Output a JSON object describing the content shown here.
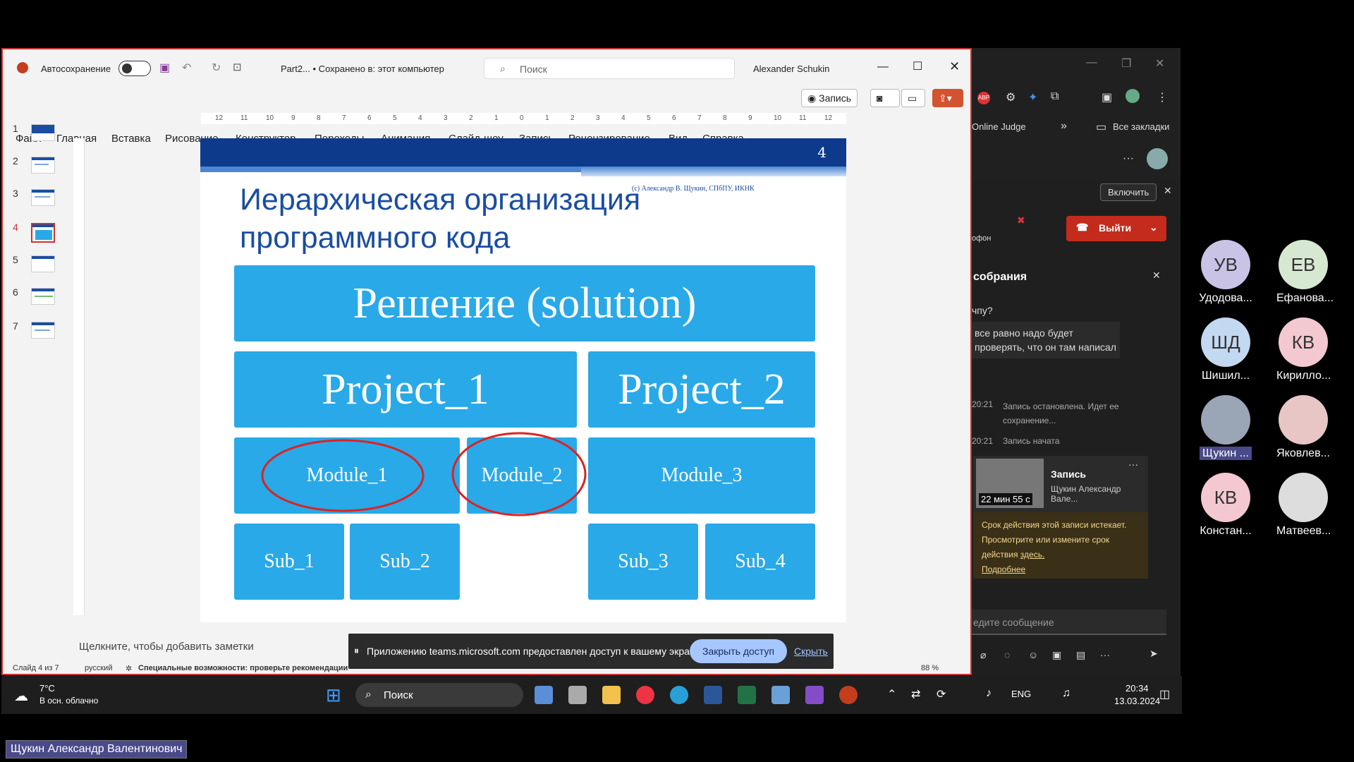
{
  "ppt": {
    "autosave_label": "Автосохранение",
    "doc_title": "Part2... • Сохранено в: этот компьютер",
    "search_placeholder": "Поиск",
    "user_name": "Alexander Schukin",
    "menu": [
      "Файл",
      "Главная",
      "Вставка",
      "Рисование",
      "Конструктор",
      "Переходы",
      "Анимация",
      "Слайд-шоу",
      "Запись",
      "Рецензирование",
      "Вид",
      "Справка"
    ],
    "record_btn": "Запись",
    "thumbnails": [
      "1",
      "2",
      "3",
      "4",
      "5",
      "6",
      "7"
    ],
    "active_slide": "4",
    "ruler_ticks": [
      "12",
      "11",
      "10",
      "9",
      "8",
      "7",
      "6",
      "5",
      "4",
      "3",
      "2",
      "1",
      "0",
      "1",
      "2",
      "3",
      "4",
      "5",
      "6",
      "7",
      "8",
      "9",
      "10",
      "11",
      "12"
    ],
    "notes_placeholder": "Щелкните, чтобы добавить заметки",
    "status": {
      "slide": "Слайд 4 из 7",
      "lang": "русский",
      "accessibility": "Специальные возможности: проверьте рекомендации",
      "zoom": "88 %"
    }
  },
  "slide": {
    "number": "4",
    "copyright": "(c) Александр В. Щукин, СПбПУ, ИКНК",
    "title": "Иерархическая организация программного кода",
    "solution": "Решение (solution)",
    "project1": "Project_1",
    "project2": "Project_2",
    "module1": "Module_1",
    "module2": "Module_2",
    "module3": "Module_3",
    "sub1": "Sub_1",
    "sub2": "Sub_2",
    "sub3": "Sub_3",
    "sub4": "Sub_4"
  },
  "share": {
    "message": "Приложению teams.microsoft.com предоставлен доступ к вашему экрану.",
    "stop": "Закрыть доступ",
    "hide": "Скрыть"
  },
  "taskbar": {
    "temp": "7°C",
    "weather": "В осн. облачно",
    "search": "Поиск",
    "lang": "ENG",
    "time": "20:34",
    "date": "13.03.2024"
  },
  "browser": {
    "bookmark1": "Online Judge",
    "bookmark2": "Все закладки"
  },
  "teams": {
    "enable": "Включить",
    "mic": "офон",
    "leave": "Выйти",
    "chat_title": "собрания",
    "msg1": "чпу?",
    "msg2": "все равно надо будет проверять, что он там написал",
    "time1": "20:21",
    "event1": "Запись остановлена. Идет ее сохранение...",
    "time2": "20:21",
    "event2": "Запись начата",
    "rec_title": "Запись",
    "rec_author": "Щукин Александр Вале...",
    "rec_duration": "22 мин 55 с",
    "rec_warn": "Срок действия этой записи истекает. Просмотрите или измените срок действия",
    "rec_here": "здесь.",
    "rec_more": "Подробнее",
    "compose": "едите сообщение"
  },
  "participants": [
    {
      "initials": "УВ",
      "name": "Удодова..."
    },
    {
      "initials": "ЕВ",
      "name": "Ефанова..."
    },
    {
      "initials": "ШД",
      "name": "Шишил..."
    },
    {
      "initials": "КВ",
      "name": "Кирилло..."
    },
    {
      "initials": "",
      "name": "Щукин ..."
    },
    {
      "initials": "",
      "name": "Яковлев..."
    },
    {
      "initials": "КВ",
      "name": "Констан..."
    },
    {
      "initials": "",
      "name": "Матвеев..."
    }
  ],
  "presenter": "Щукин Александр Валентинович"
}
